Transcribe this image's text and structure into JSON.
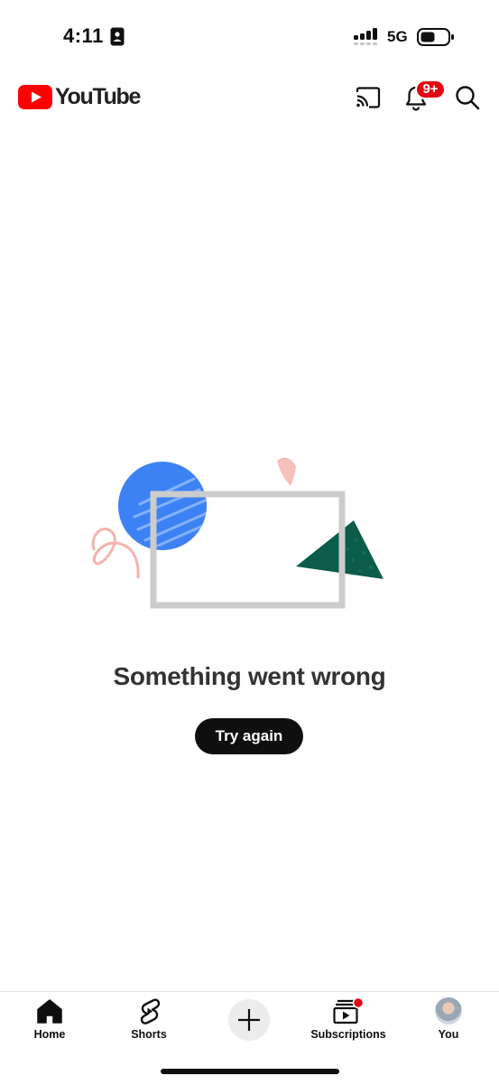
{
  "status_bar": {
    "time": "4:11",
    "network": "5G"
  },
  "header": {
    "logo_text": "YouTube",
    "notification_count": "9+"
  },
  "error": {
    "title": "Something went wrong",
    "retry_label": "Try again"
  },
  "bottom_nav": {
    "home": "Home",
    "shorts": "Shorts",
    "subscriptions": "Subscriptions",
    "you": "You"
  },
  "colors": {
    "brand_red": "#ff0000",
    "badge_red": "#e30613",
    "circle_blue": "#3d82f5",
    "triangle_green": "#0b5c4a",
    "frame_gray": "#cccccc",
    "accent_pink": "#f4b3ae"
  }
}
